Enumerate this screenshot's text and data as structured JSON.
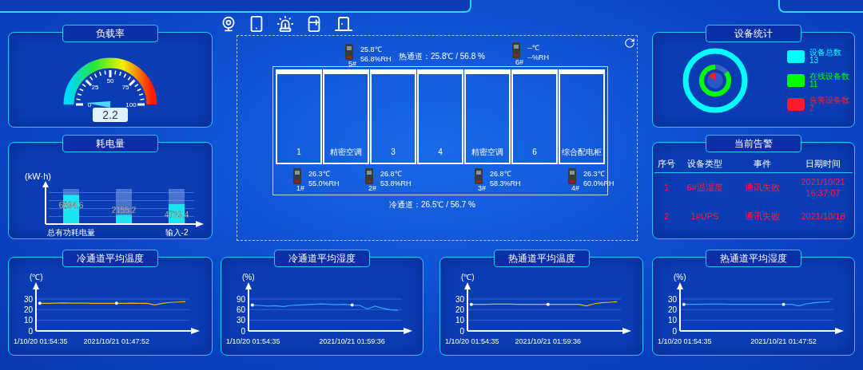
{
  "load_rate": {
    "title": "负载率",
    "scale_labels": [
      "0",
      "25",
      "50",
      "75",
      "100"
    ],
    "value": "2.2"
  },
  "energy": {
    "title": "耗电量",
    "chart_data": {
      "type": "bar",
      "ylabel": "(kW·h)",
      "categories": [
        "总有功耗电量",
        null,
        "输入-2"
      ],
      "values": [
        6894.6,
        2155.2,
        4739.4
      ],
      "ylim": [
        0,
        7500
      ],
      "data_labels": true
    }
  },
  "room": {
    "hot_aisle": "热通道：25.8℃ / 56.8 %",
    "cold_aisle": "冷通道：26.5℃ / 56.7 %",
    "cabinets": [
      {
        "label": "1"
      },
      {
        "label": "精密空调"
      },
      {
        "label": "3"
      },
      {
        "label": "4"
      },
      {
        "label": "精密空调"
      },
      {
        "label": "6"
      },
      {
        "label": "综合配电柜"
      }
    ],
    "sensors": [
      {
        "id": "5#",
        "temperature": "25.8℃",
        "humidity": "56.8%RH"
      },
      {
        "id": "6#",
        "temperature": "--℃",
        "humidity": "--%RH"
      },
      {
        "id": "1#",
        "temperature": "26.3℃",
        "humidity": "55.0%RH"
      },
      {
        "id": "2#",
        "temperature": "26.8℃",
        "humidity": "53.8%RH"
      },
      {
        "id": "3#",
        "temperature": "26.8℃",
        "humidity": "58.3%RH"
      },
      {
        "id": "4#",
        "temperature": "26.3℃",
        "humidity": "60.0%RH"
      }
    ]
  },
  "device_stats": {
    "title": "设备统计",
    "items": [
      {
        "label": "设备总数",
        "count": "13",
        "color": "#00ffff"
      },
      {
        "label": "在线设备数",
        "count": "11",
        "color": "#00ff00"
      },
      {
        "label": "告警设备数",
        "count": "2",
        "color": "#ff1a2e"
      }
    ]
  },
  "alarms": {
    "title": "当前告警",
    "columns": [
      "序号",
      "设备类型",
      "事件",
      "日期时间"
    ],
    "rows": [
      {
        "cells": [
          "1",
          "6#温湿度",
          "通讯失败",
          "2021/10/21 16:37:07"
        ]
      },
      {
        "cells": [
          "2",
          "1#UPS",
          "通讯失败",
          "2021/10/18"
        ]
      }
    ]
  },
  "charts": [
    {
      "title": "冷通道平均温度",
      "chart_data": {
        "type": "line",
        "ylabel": "(℃)",
        "ylim": [
          0,
          30
        ],
        "yticks": [
          0,
          10,
          20,
          30
        ],
        "categories": [
          "1/10/20 01:54:35",
          null,
          null,
          null,
          null,
          null,
          null,
          null,
          null,
          null,
          "2021/10/21 01:47:52",
          null,
          null,
          null,
          null,
          null,
          null,
          null,
          null,
          null
        ],
        "series": [
          {
            "color": "#f0b400",
            "values": [
              26,
              26,
              26.2,
              26.3,
              26.2,
              26.1,
              26.2,
              26,
              26,
              26,
              26,
              26,
              26.1,
              26,
              26,
              24.5,
              26,
              26.8,
              27.2,
              27.5
            ]
          }
        ]
      }
    },
    {
      "title": "冷通道平均湿度",
      "chart_data": {
        "type": "line",
        "ylabel": "(%)",
        "ylim": [
          0,
          90
        ],
        "yticks": [
          0,
          30,
          60,
          90
        ],
        "categories": [
          "1/10/20 01:54:35",
          null,
          null,
          null,
          null,
          null,
          null,
          null,
          null,
          null,
          null,
          null,
          null,
          "2021/10/21 01:59:36",
          null,
          null,
          null,
          null,
          null,
          null
        ],
        "series": [
          {
            "color": "#2ea8ff",
            "values": [
              73,
              72,
              70,
              71,
              69,
              72,
              73,
              74,
              75,
              76,
              75,
              74,
              75,
              73,
              72,
              62,
              70,
              64,
              60,
              58
            ]
          }
        ]
      }
    },
    {
      "title": "热通道平均温度",
      "chart_data": {
        "type": "line",
        "ylabel": "(℃)",
        "ylim": [
          0,
          30
        ],
        "yticks": [
          0,
          10,
          20,
          30
        ],
        "categories": [
          "1/10/20 01:54:35",
          null,
          null,
          null,
          null,
          null,
          null,
          null,
          null,
          null,
          "2021/10/21 01:59:36",
          null,
          null,
          null,
          null,
          null,
          null,
          null,
          null,
          null
        ],
        "series": [
          {
            "color": "#f0b400",
            "values": [
              25,
              25,
              25,
              25.2,
              25.3,
              25.2,
              25,
              25.1,
              25,
              25,
              25,
              25,
              25,
              25,
              25,
              23.5,
              25.5,
              26.5,
              27,
              27.5
            ]
          }
        ]
      }
    },
    {
      "title": "热通道平均湿度",
      "chart_data": {
        "type": "line",
        "ylabel": "(%)",
        "ylim": [
          0,
          30
        ],
        "yticks": [
          0,
          10,
          20,
          30
        ],
        "categories": [
          "1/10/20 01:54:35",
          null,
          null,
          null,
          null,
          null,
          null,
          null,
          null,
          null,
          null,
          null,
          null,
          "2021/10/21 01:47:52",
          null,
          null,
          null,
          null,
          null,
          null
        ],
        "series": [
          {
            "color": "#2ea8ff",
            "values": [
              25,
              25,
              25,
              25.2,
              25.3,
              25.2,
              25,
              25.1,
              25,
              25,
              25,
              25,
              25,
              25,
              25,
              23.5,
              25.5,
              26.5,
              27,
              27.5
            ]
          }
        ]
      }
    }
  ]
}
